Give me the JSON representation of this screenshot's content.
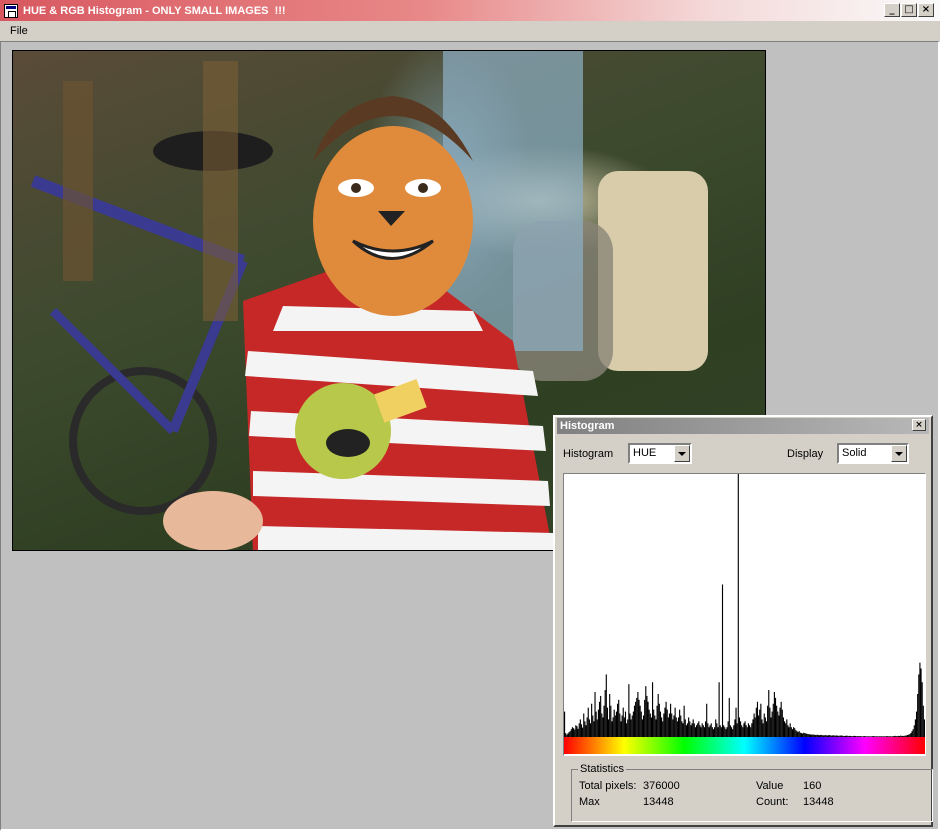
{
  "window": {
    "title": "HUE & RGB Histogram - ONLY SMALL IMAGES  !!!",
    "buttons": {
      "minimize": "_",
      "maximize": "□",
      "close": "×"
    }
  },
  "menu": {
    "items": [
      {
        "label": "File"
      }
    ]
  },
  "histogram_panel": {
    "title": "Histogram",
    "close_label": "×",
    "histogram_label": "Histogram",
    "histogram_value": "HUE",
    "display_label": "Display",
    "display_value": "Solid"
  },
  "statistics": {
    "legend": "Statistics",
    "total_pixels_label": "Total pixels:",
    "total_pixels_value": "376000",
    "max_label": "Max",
    "max_value": "13448",
    "value_label": "Value",
    "value_value": "160",
    "count_label": "Count:",
    "count_value": "13448"
  },
  "chart_data": {
    "type": "bar",
    "xlim": [
      0,
      360
    ],
    "ylim": [
      0,
      13448
    ],
    "hue_bar_colors": [
      "#ff0000",
      "#ffff00",
      "#00ff00",
      "#00ffff",
      "#0000ff",
      "#ff00ff",
      "#ff0000"
    ],
    "bar_color": "#000000",
    "values": [
      1300,
      200,
      120,
      180,
      250,
      300,
      400,
      500,
      450,
      380,
      600,
      550,
      420,
      700,
      900,
      650,
      480,
      1200,
      800,
      600,
      1000,
      1500,
      900,
      700,
      1700,
      1100,
      800,
      2300,
      1300,
      900,
      1400,
      1800,
      2100,
      1200,
      1000,
      1600,
      2400,
      3200,
      1500,
      900,
      2200,
      1600,
      800,
      1000,
      1400,
      1100,
      1300,
      1700,
      1900,
      1200,
      800,
      1100,
      1500,
      1000,
      1300,
      700,
      900,
      2700,
      1200,
      900,
      1100,
      1300,
      1600,
      1800,
      2000,
      2300,
      1900,
      1600,
      1300,
      900,
      1100,
      1900,
      2600,
      2100,
      1800,
      1400,
      1200,
      1000,
      2800,
      1400,
      1100,
      900,
      1600,
      2200,
      1700,
      1300,
      1000,
      800,
      1200,
      1500,
      1800,
      1400,
      1000,
      1200,
      1700,
      1200,
      900,
      1100,
      1500,
      1000,
      800,
      1000,
      1400,
      1100,
      800,
      700,
      1600,
      900,
      600,
      700,
      1000,
      800,
      600,
      700,
      900,
      700,
      500,
      600,
      700,
      800,
      600,
      500,
      700,
      600,
      500,
      800,
      1700,
      700,
      500,
      600,
      700,
      500,
      400,
      500,
      900,
      700,
      500,
      2800,
      600,
      500,
      7800,
      600,
      500,
      400,
      500,
      800,
      2000,
      600,
      500,
      400,
      600,
      900,
      1500,
      700,
      13448,
      1000,
      800,
      600,
      500,
      700,
      800,
      600,
      500,
      700,
      600,
      500,
      700,
      900,
      1200,
      1000,
      1500,
      1800,
      1100,
      1400,
      1700,
      900,
      700,
      1200,
      1000,
      800,
      1600,
      2400,
      1500,
      1000,
      1300,
      1700,
      2300,
      2000,
      1600,
      1300,
      1100,
      1500,
      1800,
      1400,
      1000,
      800,
      700,
      900,
      600,
      500,
      700,
      500,
      400,
      500,
      450,
      350,
      300,
      250,
      300,
      220,
      200,
      180,
      220,
      200,
      180,
      160,
      150,
      140,
      130,
      120,
      130,
      120,
      110,
      100,
      120,
      100,
      90,
      110,
      100,
      90,
      80,
      100,
      90,
      80,
      90,
      100,
      80,
      70,
      90,
      80,
      70,
      80,
      70,
      60,
      70,
      80,
      70,
      60,
      50,
      60,
      70,
      60,
      50,
      60,
      50,
      40,
      50,
      60,
      50,
      40,
      50,
      40,
      50,
      40,
      30,
      40,
      50,
      40,
      30,
      40,
      30,
      40,
      30,
      40,
      50,
      40,
      30,
      40,
      30,
      40,
      30,
      40,
      30,
      40,
      30,
      40,
      50,
      40,
      30,
      40,
      30,
      40,
      50,
      60,
      50,
      40,
      60,
      50,
      70,
      60,
      50,
      60,
      70,
      80,
      100,
      120,
      150,
      200,
      300,
      400,
      600,
      900,
      1300,
      2200,
      3200,
      3800,
      3500,
      2800,
      1600,
      900
    ]
  }
}
